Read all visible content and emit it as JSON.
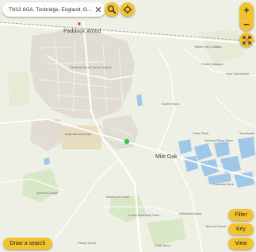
{
  "search": {
    "value": "TN12 6GA, Tonbridge, England, G..."
  },
  "icons": {
    "search": "search-icon",
    "locate": "crosshair-icon",
    "fullscreen": "fullscreen-icon",
    "clear": "close-icon"
  },
  "controls": {
    "zoom_in": "+",
    "zoom_out": "−",
    "clear": "✕"
  },
  "buttons": {
    "filter": "Filter",
    "key": "Key",
    "view": "View",
    "draw": "Draw a search"
  },
  "places": {
    "paddock_wood": "Paddock Wood",
    "mile_oak": "Mile Oak",
    "black_lion": "Black Lion Cottage",
    "pouitt": "Pouitt Cottages",
    "park_farmhouse": "Park Farmhouse",
    "knells": "Knell's Farm",
    "catts": "Catts Place",
    "orchard": "Orchard Place Farm",
    "woodsden": "Woodsden",
    "tranchan": "Tranchan Farm",
    "woodsden_farm": "Woodsden Farm",
    "lower_breedhay": "Lower Breedhay Farm",
    "whetsted": "Whetsted Wood",
    "brenne": "Brenne House",
    "pearly": "Pearly Wood",
    "paddock_wood_junior": "Paddock Wood Junior School",
    "mascalls": "Mascalls Academy",
    "queens": "Queen's Lodge",
    "park_wood": "Park Wood"
  },
  "colors": {
    "accent": "#f2c230",
    "water": "#9fc7e8",
    "marker": "#2ecc40",
    "road": "#ffffff"
  }
}
